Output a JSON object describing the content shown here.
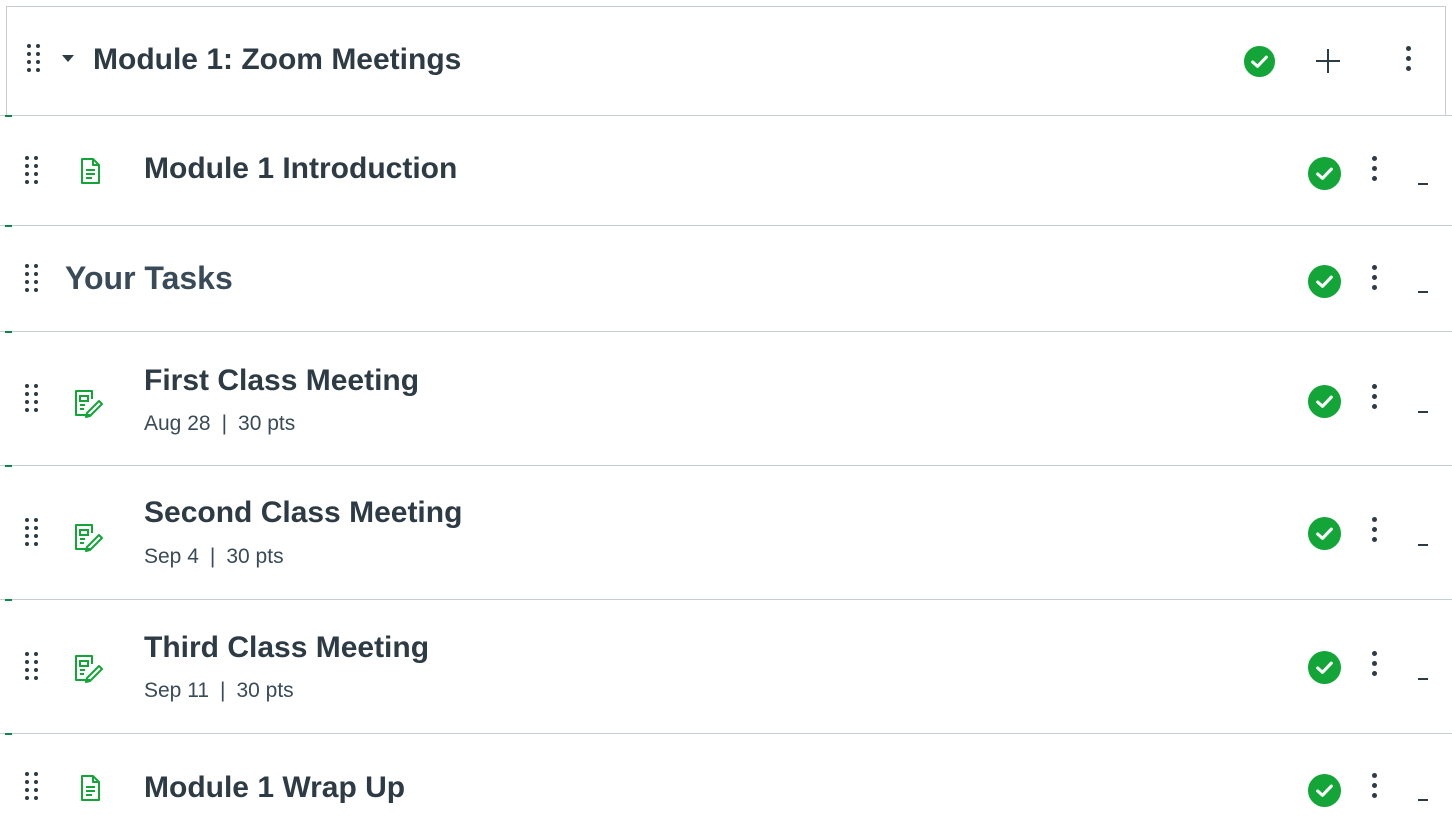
{
  "module": {
    "title": "Module 1: Zoom Meetings",
    "published": true,
    "icons": {
      "drag": "drag-handle-icon",
      "collapse": "caret-down-icon",
      "published": "check-circle-icon",
      "add": "plus-icon",
      "menu": "kebab-menu-icon"
    }
  },
  "colors": {
    "text": "#2d3b45",
    "published_green": "#0b874b",
    "icon_green": "#13a538",
    "border": "#c7cdd1"
  },
  "items": [
    {
      "title": "Module 1 Introduction",
      "type": "page",
      "icon": "page-icon",
      "published": true
    },
    {
      "title": "Your Tasks",
      "type": "subheader",
      "published": true
    },
    {
      "title": "First Class Meeting",
      "type": "assignment",
      "icon": "assignment-icon",
      "due": "Aug 28",
      "separator": "|",
      "points": "30 pts",
      "published": true
    },
    {
      "title": "Second Class Meeting",
      "type": "assignment",
      "icon": "assignment-icon",
      "due": "Sep 4",
      "separator": "|",
      "points": "30 pts",
      "published": true
    },
    {
      "title": "Third Class Meeting",
      "type": "assignment",
      "icon": "assignment-icon",
      "due": "Sep 11",
      "separator": "|",
      "points": "30 pts",
      "published": true
    },
    {
      "title": "Module 1 Wrap Up",
      "type": "page",
      "icon": "page-icon",
      "published": true
    }
  ]
}
